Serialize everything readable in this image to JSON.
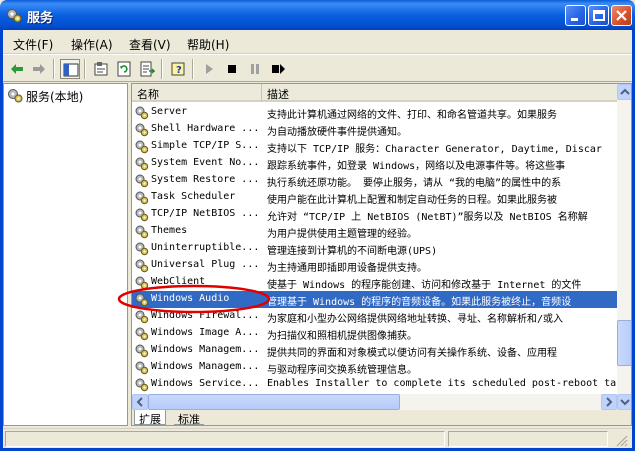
{
  "window": {
    "title": "服务",
    "icon": "gears-icon"
  },
  "menu": [
    "文件(F)",
    "操作(A)",
    "查看(V)",
    "帮助(H)"
  ],
  "toolbar_icons": [
    "back-arrow-icon",
    "forward-arrow-icon",
    "console-tree-icon",
    "properties-icon",
    "refresh-icon",
    "export-list-icon",
    "help-icon",
    "start-service-icon",
    "stop-service-icon",
    "pause-service-icon",
    "restart-service-icon"
  ],
  "tree": {
    "root_label": "服务(本地)"
  },
  "list": {
    "columns": [
      "名称",
      "描述"
    ],
    "rows": [
      {
        "name": "Server",
        "desc": "支持此计算机通过网络的文件、打印、和命名管道共享。如果服务"
      },
      {
        "name": "Shell Hardware ...",
        "desc": "为自动播放硬件事件提供通知。"
      },
      {
        "name": "Simple TCP/IP S...",
        "desc": "支持以下 TCP/IP 服务：Character Generator, Daytime, Discar"
      },
      {
        "name": "System Event No...",
        "desc": "跟踪系统事件，如登录 Windows，网络以及电源事件等。将这些事"
      },
      {
        "name": "System Restore ...",
        "desc": "执行系统还原功能。 要停止服务，请从 “我的电脑”的属性中的系"
      },
      {
        "name": "Task Scheduler",
        "desc": "使用户能在此计算机上配置和制定自动任务的日程。如果此服务被"
      },
      {
        "name": "TCP/IP NetBIOS ...",
        "desc": "允许对 “TCP/IP 上 NetBIOS (NetBT)”服务以及 NetBIOS 名称解"
      },
      {
        "name": "Themes",
        "desc": "为用户提供使用主题管理的经验。"
      },
      {
        "name": "Uninterruptible...",
        "desc": "管理连接到计算机的不间断电源(UPS)"
      },
      {
        "name": "Universal Plug ...",
        "desc": "为主持通用即插即用设备提供支持。"
      },
      {
        "name": "WebClient",
        "desc": "使基于 Windows 的程序能创建、访问和修改基于 Internet 的文件"
      },
      {
        "name": "Windows Audio",
        "desc": "管理基于 Windows 的程序的音频设备。如果此服务被终止，音频设"
      },
      {
        "name": "Windows Firewal...",
        "desc": "为家庭和小型办公网络提供网络地址转换、寻址、名称解析和/或入"
      },
      {
        "name": "Windows Image A...",
        "desc": "为扫描仪和照相机提供图像捕获。"
      },
      {
        "name": "Windows Managem...",
        "desc": "提供共同的界面和对象模式以便访问有关操作系统、设备、应用程"
      },
      {
        "name": "Windows Managem...",
        "desc": "与驱动程序间交换系统管理信息。"
      },
      {
        "name": "Windows Service...",
        "desc": "Enables Installer to complete its scheduled post-reboot ta"
      }
    ],
    "selected_index": 11
  },
  "tabs": [
    "扩展",
    "标准"
  ],
  "colors": {
    "selection": "#316AC5",
    "annotation": "#E00000",
    "titlebar": "#0A5FE0"
  }
}
